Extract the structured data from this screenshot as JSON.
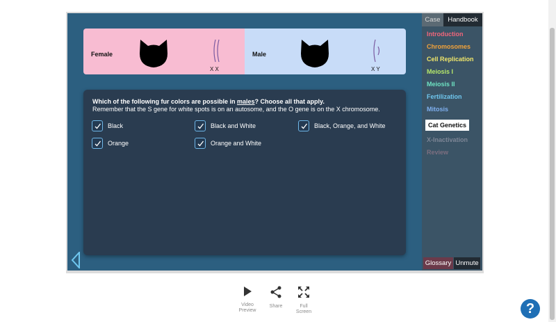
{
  "panel": {
    "female_label": "Female",
    "male_label": "Male",
    "female_chromosomes": "X  X",
    "male_chromosomes": "X  Y"
  },
  "question": {
    "prefix": "Which of the following fur colors are possible in ",
    "emphasis": "males",
    "suffix": "? Choose all that apply.",
    "hint": "Remember that the S gene for white spots is on an autosome, and the O gene is on the X chromosome."
  },
  "options": [
    {
      "label": "Black",
      "checked": true
    },
    {
      "label": "Black and White",
      "checked": true
    },
    {
      "label": "Black, Orange, and White",
      "checked": true
    },
    {
      "label": "Orange",
      "checked": true
    },
    {
      "label": "Orange and White",
      "checked": true
    }
  ],
  "sidebar": {
    "tabs": {
      "case": "Case",
      "handbook": "Handbook"
    },
    "items": [
      {
        "label": "Introduction",
        "color": "#f0667a"
      },
      {
        "label": "Chromosomes",
        "color": "#f2a23a"
      },
      {
        "label": "Cell Replication",
        "color": "#f0e66a"
      },
      {
        "label": "Meiosis I",
        "color": "#b6e86a"
      },
      {
        "label": "Meiosis II",
        "color": "#6ee3c3"
      },
      {
        "label": "Fertilization",
        "color": "#6fc7ef"
      },
      {
        "label": "Mitosis",
        "color": "#7fb0f0"
      },
      {
        "label": "Cat Genetics",
        "color": "#111111"
      },
      {
        "label": "X-Inactivation",
        "color": "#7d8696"
      },
      {
        "label": "Review",
        "color": "#7d6f80"
      }
    ],
    "glossary": "Glossary",
    "unmute": "Unmute"
  },
  "toolbar": {
    "video_preview": [
      "Video",
      "Preview"
    ],
    "share": "Share",
    "full_screen": [
      "Full",
      "Screen"
    ]
  },
  "help": "?",
  "colors": {
    "stage": "#2c5f80",
    "female_bg": "#f8bcd2",
    "male_bg": "#c8dcf8",
    "card": "#2a3c50",
    "checkbox": "#6fb7e8"
  }
}
